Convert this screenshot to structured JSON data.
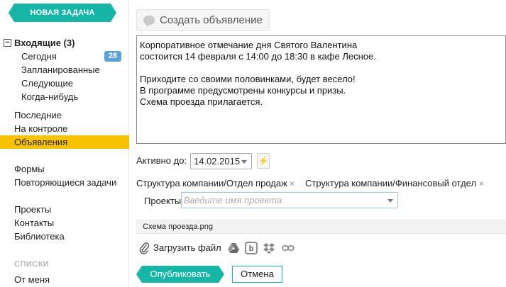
{
  "sidebar": {
    "new_task": "НОВАЯ ЗАДАЧА",
    "inbox": {
      "collapse": "−",
      "label": "Входящие (3)"
    },
    "inbox_items": [
      {
        "label": "Сегодня",
        "badge": "28"
      },
      {
        "label": "Запланированные"
      },
      {
        "label": "Следующие"
      },
      {
        "label": "Когда-нибудь"
      }
    ],
    "group1": [
      "Последние",
      "На контроле",
      "Объявления"
    ],
    "active_item": "Объявления",
    "group2": [
      "Формы",
      "Повторяющиеся задачи"
    ],
    "group3": [
      "Проекты",
      "Контакты",
      "Библиотека"
    ],
    "lists_label": "СПИСКИ",
    "group4": [
      "От меня"
    ]
  },
  "main": {
    "create_ad": "Создать объявление",
    "editor_lines": [
      "Корпоративное отмечание дня Святого Валентина",
      "состоится 14 февраля с 14:00 до 18:30 в кафе Лесное.",
      "",
      "Приходите со своими половинками, будет весело!",
      "В программе предусмотрены конкурсы и призы.",
      "Схема проезда прилагается."
    ],
    "active_until_label": "Активно до:",
    "active_until_value": "14.02.2015",
    "tags": [
      "Структура компании/Отдел продаж",
      "Структура компании/Финансовый отдел"
    ],
    "tag_remove_glyph": "×",
    "projects_label": "Проекты:",
    "projects_placeholder": "Введите имя проекта",
    "attached_file": "Схема проезда.png",
    "upload_label": "Загрузить файл",
    "upload_services": [
      "google-drive-icon",
      "box-icon",
      "dropbox-icon",
      "link-icon"
    ],
    "publish": "Опубликовать",
    "cancel": "Отмена"
  },
  "colors": {
    "accent": "#17b5a6",
    "active_nav": "#f7c200",
    "badge": "#5aa0da"
  }
}
